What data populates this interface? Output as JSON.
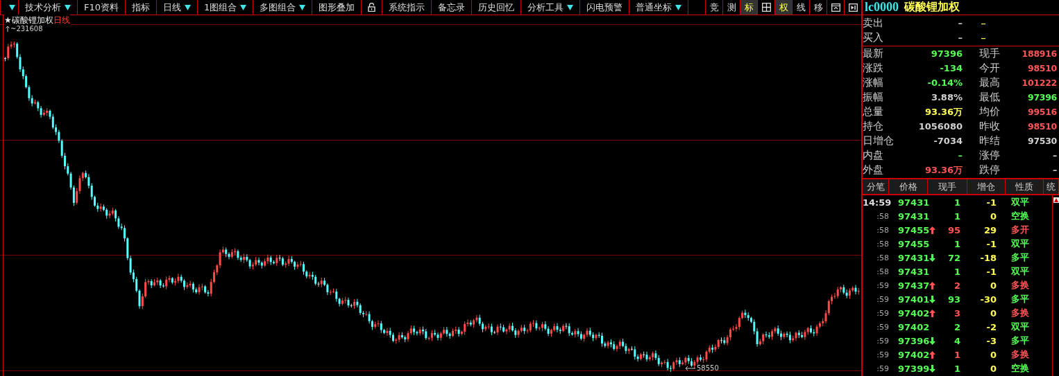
{
  "toolbar": {
    "items": [
      {
        "kind": "menu"
      },
      {
        "kind": "button",
        "label": "技术分析",
        "dropdown": true
      },
      {
        "kind": "button",
        "label": "F10资料",
        "dropdown": false
      },
      {
        "kind": "button",
        "label": "指标",
        "dropdown": false
      },
      {
        "kind": "button",
        "label": "日线",
        "dropdown": true
      },
      {
        "kind": "button",
        "label": "1图组合",
        "dropdown": true
      },
      {
        "kind": "button",
        "label": "多图组合",
        "dropdown": true
      },
      {
        "kind": "button",
        "label": "图形叠加",
        "dropdown": false
      },
      {
        "kind": "lock"
      },
      {
        "kind": "button",
        "label": "系统指示",
        "dropdown": false
      },
      {
        "kind": "button",
        "label": "备忘录",
        "dropdown": false
      },
      {
        "kind": "button",
        "label": "历史回忆",
        "dropdown": false
      },
      {
        "kind": "button",
        "label": "分析工具",
        "dropdown": true
      },
      {
        "kind": "button",
        "label": "闪电预警",
        "dropdown": false
      },
      {
        "kind": "button",
        "label": "普通坐标",
        "dropdown": true
      }
    ],
    "tools": [
      {
        "kind": "text",
        "label": "竞",
        "selected": false
      },
      {
        "kind": "text",
        "label": "测",
        "selected": false
      },
      {
        "kind": "text",
        "label": "标",
        "selected": true
      },
      {
        "kind": "grid",
        "selected": false
      },
      {
        "kind": "text",
        "label": "权",
        "selected": true
      },
      {
        "kind": "text",
        "label": "线",
        "selected": false
      },
      {
        "kind": "text",
        "label": "移",
        "selected": false
      },
      {
        "kind": "window",
        "selected": false
      },
      {
        "kind": "next",
        "selected": false
      }
    ]
  },
  "chart": {
    "name": "★碳酸锂加权",
    "period": "日线",
    "high_label": "~231608",
    "low_label": "58550"
  },
  "quote": {
    "code": "lc0000",
    "name": "碳酸锂加权",
    "book": [
      {
        "label": "卖出",
        "price": "–",
        "volume": "–"
      },
      {
        "label": "买入",
        "price": "–",
        "volume": "–"
      }
    ],
    "stats": [
      {
        "left": {
          "label": "最新",
          "value": "97396",
          "color": "#55ff55"
        },
        "right": {
          "label": "现手",
          "value": "188916",
          "color": "#ff5555"
        }
      },
      {
        "left": {
          "label": "涨跌",
          "value": "-134",
          "color": "#55ff55"
        },
        "right": {
          "label": "今开",
          "value": "98510",
          "color": "#ff5555"
        }
      },
      {
        "left": {
          "label": "涨幅",
          "value": "-0.14%",
          "color": "#55ff55"
        },
        "right": {
          "label": "最高",
          "value": "101222",
          "color": "#ff5555"
        }
      },
      {
        "left": {
          "label": "振幅",
          "value": "3.88%",
          "color": "#d0d0d0"
        },
        "right": {
          "label": "最低",
          "value": "97396",
          "color": "#55ff55"
        }
      },
      {
        "left": {
          "label": "总量",
          "value": "93.36万",
          "color": "#ffff55"
        },
        "right": {
          "label": "均价",
          "value": "99516",
          "color": "#ff5555"
        }
      },
      {
        "left": {
          "label": "持仓",
          "value": "1056080",
          "color": "#d0d0d0"
        },
        "right": {
          "label": "昨收",
          "value": "98510",
          "color": "#ff5555"
        }
      },
      {
        "left": {
          "label": "日增仓",
          "value": "-7034",
          "color": "#d0d0d0"
        },
        "right": {
          "label": "昨结",
          "value": "97530",
          "color": "#d0d0d0"
        }
      },
      {
        "left": {
          "label": "内盘",
          "value": "–",
          "color": "#55ff55"
        },
        "right": {
          "label": "涨停",
          "value": "–",
          "color": "#d0d0d0"
        }
      },
      {
        "left": {
          "label": "外盘",
          "value": "93.36万",
          "color": "#ff5555"
        },
        "right": {
          "label": "跌停",
          "value": "–",
          "color": "#d0d0d0"
        }
      }
    ]
  },
  "ticks": {
    "columns": [
      "分笔",
      "价格",
      "现手",
      "增仓",
      "性质",
      "统"
    ],
    "rows": [
      {
        "kind": "plain",
        "time": "14:59",
        "price": "97431",
        "volume": {
          "text": "1",
          "color": "#55ff55"
        },
        "oi": "-1",
        "nature": {
          "text": "双平",
          "color": "#55ff55"
        }
      },
      {
        "kind": "plain",
        "time": ":58",
        "price": "97431",
        "volume": {
          "text": "1",
          "color": "#55ff55"
        },
        "oi": "0",
        "nature": {
          "text": "空换",
          "color": "#55ff55"
        }
      },
      {
        "kind": "up",
        "time": ":58",
        "price": "97455",
        "volume": {
          "text": "95",
          "color": "#ff5555"
        },
        "oi": "29",
        "nature": {
          "text": "多开",
          "color": "#ff5555"
        }
      },
      {
        "kind": "plain",
        "time": ":58",
        "price": "97455",
        "volume": {
          "text": "1",
          "color": "#55ff55"
        },
        "oi": "-1",
        "nature": {
          "text": "双平",
          "color": "#55ff55"
        }
      },
      {
        "kind": "down",
        "time": ":58",
        "price": "97431",
        "volume": {
          "text": "72",
          "color": "#55ff55"
        },
        "oi": "-18",
        "nature": {
          "text": "多平",
          "color": "#55ff55"
        }
      },
      {
        "kind": "plain",
        "time": ":58",
        "price": "97431",
        "volume": {
          "text": "1",
          "color": "#55ff55"
        },
        "oi": "-1",
        "nature": {
          "text": "双平",
          "color": "#55ff55"
        }
      },
      {
        "kind": "up",
        "time": ":59",
        "price": "97437",
        "volume": {
          "text": "2",
          "color": "#ff5555"
        },
        "oi": "0",
        "nature": {
          "text": "多换",
          "color": "#ff5555"
        }
      },
      {
        "kind": "down",
        "time": ":59",
        "price": "97401",
        "volume": {
          "text": "93",
          "color": "#55ff55"
        },
        "oi": "-30",
        "nature": {
          "text": "多平",
          "color": "#55ff55"
        }
      },
      {
        "kind": "up",
        "time": ":59",
        "price": "97402",
        "volume": {
          "text": "3",
          "color": "#ff5555"
        },
        "oi": "0",
        "nature": {
          "text": "多换",
          "color": "#ff5555"
        }
      },
      {
        "kind": "plain",
        "time": ":59",
        "price": "97402",
        "volume": {
          "text": "2",
          "color": "#55ff55"
        },
        "oi": "-2",
        "nature": {
          "text": "双平",
          "color": "#55ff55"
        }
      },
      {
        "kind": "down",
        "time": ":59",
        "price": "97396",
        "volume": {
          "text": "4",
          "color": "#55ff55"
        },
        "oi": "-3",
        "nature": {
          "text": "多平",
          "color": "#55ff55"
        }
      },
      {
        "kind": "up",
        "time": ":59",
        "price": "97402",
        "volume": {
          "text": "1",
          "color": "#ff5555"
        },
        "oi": "0",
        "nature": {
          "text": "多换",
          "color": "#ff5555"
        }
      },
      {
        "kind": "down",
        "time": ":59",
        "price": "97399",
        "volume": {
          "text": "1",
          "color": "#55ff55"
        },
        "oi": "0",
        "nature": {
          "text": "空换",
          "color": "#55ff55"
        }
      }
    ]
  }
}
